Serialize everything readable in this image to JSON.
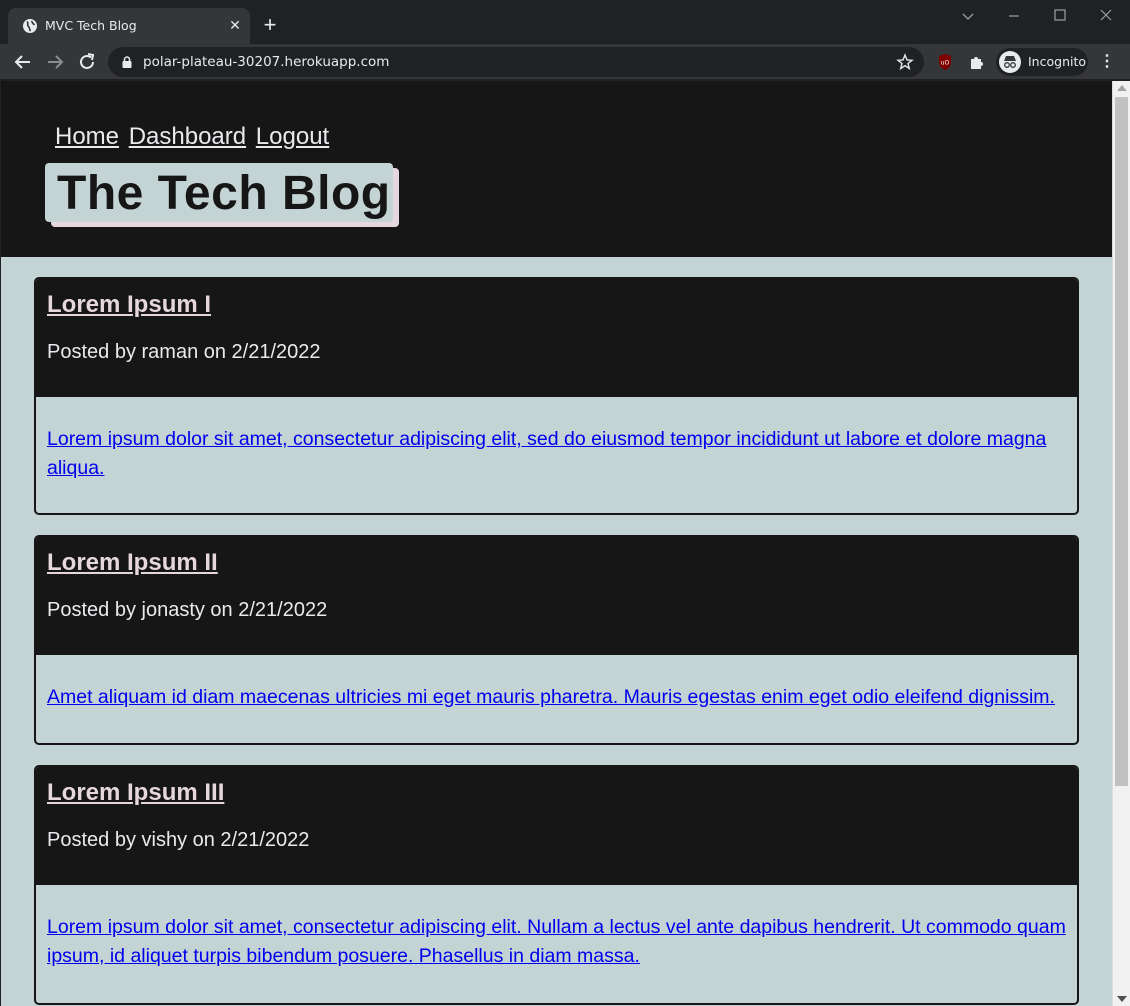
{
  "browser": {
    "tab_title": "MVC Tech Blog",
    "url": "polar-plateau-30207.herokuapp.com",
    "profile_label": "Incognito"
  },
  "site": {
    "nav": [
      "Home",
      "Dashboard",
      "Logout"
    ],
    "brand": "The Tech Blog"
  },
  "posts": [
    {
      "title": "Lorem Ipsum I",
      "meta": "Posted by raman on 2/21/2022",
      "content": "Lorem ipsum dolor sit amet, consectetur adipiscing elit, sed do eiusmod tempor incididunt ut labore et dolore magna aliqua."
    },
    {
      "title": "Lorem Ipsum II",
      "meta": "Posted by jonasty on 2/21/2022",
      "content": "Amet aliquam id diam maecenas ultricies mi eget mauris pharetra. Mauris egestas enim eget odio eleifend dignissim."
    },
    {
      "title": "Lorem Ipsum III",
      "meta": "Posted by vishy on 2/21/2022",
      "content": "Lorem ipsum dolor sit amet, consectetur adipiscing elit. Nullam a lectus vel ante dapibus hendrerit. Ut commodo quam ipsum, id aliquet turpis bibendum posuere. Phasellus in diam massa."
    }
  ],
  "colors": {
    "header_bg": "#161616",
    "page_bg": "#c4d3d3",
    "title_color": "#e6d7df",
    "link_color": "#0000ee"
  }
}
